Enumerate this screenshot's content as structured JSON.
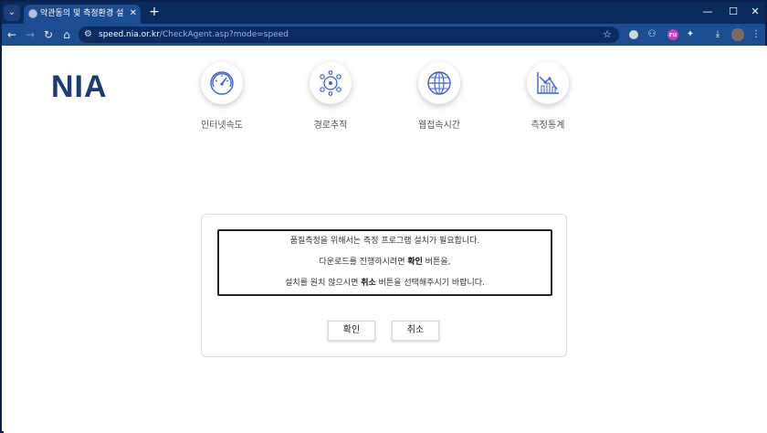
{
  "browser": {
    "tab_title": "악관동의 및 측정환경 설정 | 인",
    "url_host": "speed.nia.or.kr",
    "url_path": "/CheckAgent.asp?mode=speed",
    "ext_badge": "ru",
    "window_controls": {
      "minimize": "—",
      "maximize": "☐",
      "close": "✕"
    }
  },
  "logo": "NIA",
  "menu": [
    {
      "label": "인터넷속도",
      "icon": "speedometer-icon"
    },
    {
      "label": "경로추적",
      "icon": "route-trace-icon"
    },
    {
      "label": "웹접속시간",
      "icon": "globe-icon"
    },
    {
      "label": "측정통계",
      "icon": "statistics-icon"
    }
  ],
  "dialog": {
    "line1": "품질측정을 위해서는 측정 프로그램 설치가 필요합니다.",
    "line2_pre": "다운로드를 진행하시려면 ",
    "line2_bold": "확인",
    "line2_post": " 버튼을,",
    "line3_pre": "설치를 원치 않으시면 ",
    "line3_bold": "취소",
    "line3_post": " 버튼을 선택해주시기 바랍니다.",
    "confirm_label": "확인",
    "cancel_label": "취소"
  },
  "colors": {
    "brand": "#1a3a7a",
    "icon_blue": "#3b62d6",
    "chrome_dark": "#0a2a5c",
    "chrome_toolbar": "#1c4c92"
  }
}
